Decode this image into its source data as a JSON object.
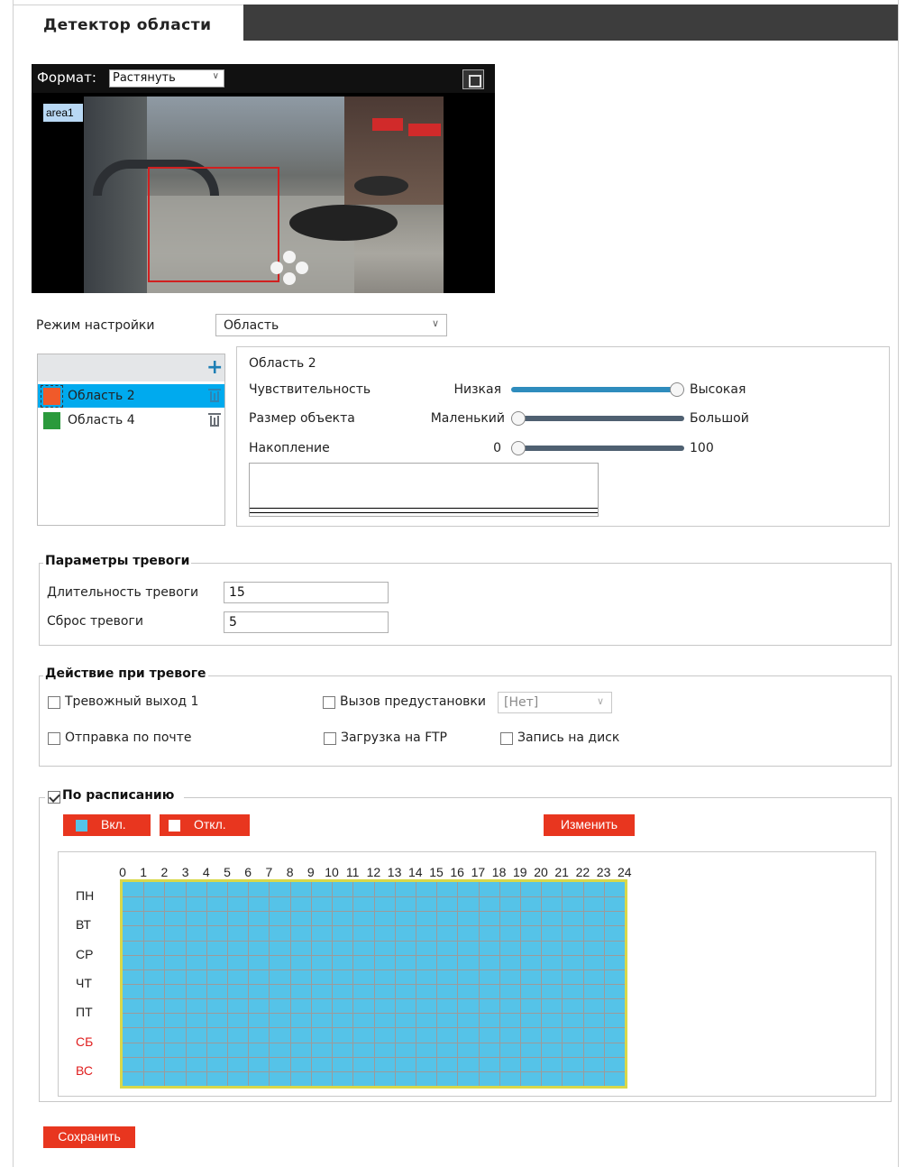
{
  "tab": {
    "title": "Детектор области"
  },
  "preview": {
    "format_label": "Формат:",
    "format_value": "Растянуть",
    "area_tag": "area1"
  },
  "mode": {
    "label": "Режим настройки",
    "value": "Область"
  },
  "areas": {
    "items": [
      {
        "label": "Область 2",
        "color": "#f05a2a",
        "selected": true
      },
      {
        "label": "Область 4",
        "color": "#2b9a3c",
        "selected": false
      }
    ]
  },
  "settings": {
    "title": "Область 2",
    "sensitivity": {
      "label": "Чувствительность",
      "min": "Низкая",
      "max": "Высокая",
      "value": 1.0
    },
    "object_size": {
      "label": "Размер объекта",
      "min": "Маленький",
      "max": "Большой",
      "value": 0.0
    },
    "accumulation": {
      "label": "Накопление",
      "min": "0",
      "max": "100",
      "value": 0
    }
  },
  "alarm_params": {
    "legend": "Параметры тревоги",
    "duration_label": "Длительность тревоги",
    "duration_value": "15",
    "reset_label": "Сброс тревоги",
    "reset_value": "5"
  },
  "alarm_actions": {
    "legend": "Действие при тревоге",
    "alarm_out": "Тревожный выход 1",
    "preset_call": "Вызов предустановки",
    "preset_value": "[Нет]",
    "email": "Отправка по почте",
    "ftp": "Загрузка на FTP",
    "record": "Запись на диск"
  },
  "schedule": {
    "legend": "По расписанию",
    "enabled": true,
    "on_label": "Вкл.",
    "off_label": "Откл.",
    "edit_label": "Изменить",
    "hours": [
      "0",
      "1",
      "2",
      "3",
      "4",
      "5",
      "6",
      "7",
      "8",
      "9",
      "10",
      "11",
      "12",
      "13",
      "14",
      "15",
      "16",
      "17",
      "18",
      "19",
      "20",
      "21",
      "22",
      "23",
      "24"
    ],
    "days": [
      {
        "label": "ПН",
        "weekend": false
      },
      {
        "label": "ВТ",
        "weekend": false
      },
      {
        "label": "СР",
        "weekend": false
      },
      {
        "label": "ЧТ",
        "weekend": false
      },
      {
        "label": "ПТ",
        "weekend": false
      },
      {
        "label": "СБ",
        "weekend": true
      },
      {
        "label": "ВС",
        "weekend": true
      }
    ],
    "active_color": "#55c3e8"
  },
  "save_label": "Сохранить",
  "colors": {
    "accent": "#e8361f",
    "selection": "#00aaee",
    "slider_fill": "#2e8cbd"
  }
}
